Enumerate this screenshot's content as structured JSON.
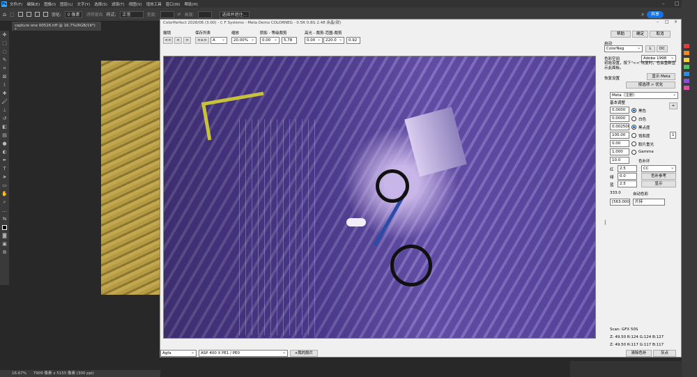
{
  "menubar": {
    "logo": "Ps",
    "items": [
      "文件(F)",
      "编辑(E)",
      "图像(I)",
      "图层(L)",
      "文字(Y)",
      "选择(S)",
      "滤镜(T)",
      "视图(V)",
      "增效工具",
      "窗口(W)",
      "帮助(H)"
    ]
  },
  "options": {
    "feather_label": "羽化:",
    "feather_value": "0 像素",
    "antialias": "消除锯齿",
    "style_label": "样式:",
    "style_value": "正常",
    "width_label": "宽度:",
    "height_label": "高度:",
    "select_subject": "选择并遮住...",
    "share": "共享"
  },
  "document": {
    "tab": "capture one 00526.tiff @ 16.7%(RGB/16*) *",
    "status_zoom": "16.67%",
    "status_size": "7909 像素 x 5155 像素 (300 ppi)"
  },
  "dialog": {
    "title": "ColorPerfect 2026/06 (3.00) - C F Systems - Meta Demo COLORNEG - 0.5R 0.8G 2.48 余晶(锐)",
    "toolbar": {
      "undo_label": "撤销",
      "undo_buttons": [
        "<<",
        "<",
        ">"
      ],
      "savelist_label": "保存列表",
      "savelist_button": "<+>",
      "savelist_value": "A",
      "zoom_label": "缩放",
      "zoom_value": "20.00%",
      "shadow_label": "阴影 - 等级裁剪",
      "shadow_value": "0.00",
      "shadow_num": "5.78",
      "highlight_label": "高光 - 裁剪-范围-裁剪",
      "highlight_value": "0.00",
      "highlight_range": "220.0",
      "highlight_num": "0.92"
    },
    "buttons": {
      "help": "帮助",
      "ok": "确定",
      "cancel": "取消"
    },
    "startup_label": "启动",
    "startup_value": "ColorNeg",
    "startup_l": "L",
    "startup_dc": "DC",
    "colorspace_label": "色彩空间",
    "colorspace_value": "Adobe 1998",
    "hint_text": "初始设置，按下\"<<\"恢复时，也会重新显示此面板。",
    "restore_label": "恢复设置",
    "show_meta": "显示 Meta",
    "options_button": "按选项 > 优化",
    "meta_value": "Meta（注册）",
    "basic_label": "基本调整",
    "plus": "+",
    "params": [
      {
        "value": "0.0000",
        "label": "黑色",
        "selected": true
      },
      {
        "value": "0.0000",
        "label": "白色",
        "selected": false
      },
      {
        "value": "0.002500",
        "label": "黑点度",
        "selected": true
      },
      {
        "value": "100.00",
        "label": "饱和度",
        "selected": false
      },
      {
        "value": "0.00",
        "label": "胶片重光",
        "selected": false
      },
      {
        "value": "1.000",
        "label": "Gamma",
        "selected": false
      }
    ],
    "sat_extra": "1",
    "filter_value": "10.0",
    "filter_label": "色补环",
    "rgb": [
      {
        "label": "红",
        "value": "2.5"
      },
      {
        "label": "绿",
        "value": "0.0"
      },
      {
        "label": "蓝",
        "value": "2.5"
      }
    ],
    "cc_value": "CC",
    "cc_ref": "色补参考",
    "display_btn": "显示",
    "temp_value": "333.0",
    "auto_label": "自动色彩",
    "kelvin_value": "[563.000",
    "film_label": "片持",
    "scan_label": "Scan: GFX 50S",
    "readout1": "Z:  49.50 R:124 G:124 B:127",
    "readout2": "Z:  49.50 R:117 G:117 B:117",
    "clear_btn": "清除色补",
    "gray_btn": "灰点",
    "film_brand": "Agfa",
    "film_type": "ASP 400 X PE1 / PE0",
    "my_film": "+我的胶片"
  },
  "colors": {
    "ps_bg": "#282828",
    "ps_panel": "#3a3a3a",
    "accent": "#1473e6",
    "swatches": [
      "#e23b3b",
      "#f08a24",
      "#f2d43a",
      "#4cc25b",
      "#2f8be0",
      "#8a4fd8",
      "#e04fa8"
    ]
  }
}
